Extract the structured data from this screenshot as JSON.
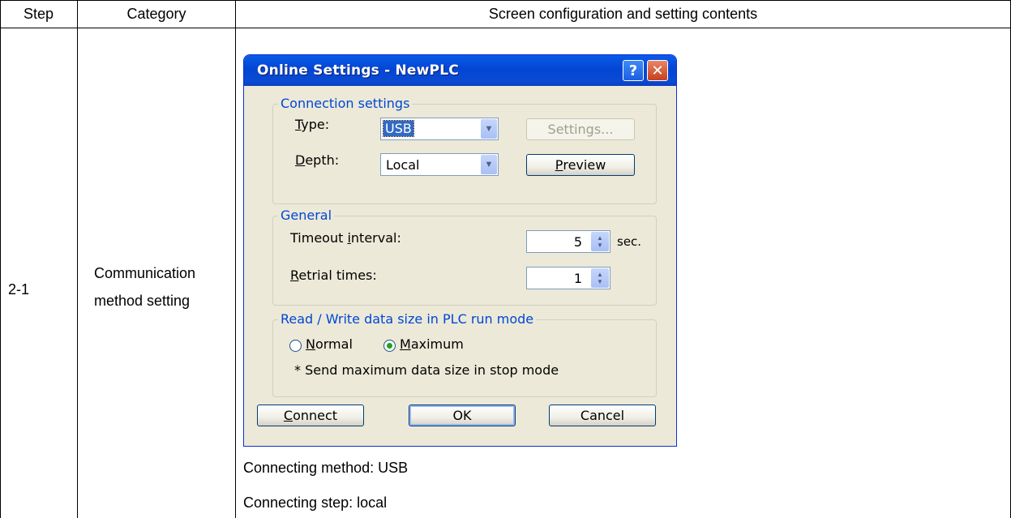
{
  "table": {
    "headers": [
      "Step",
      "Category",
      "Screen configuration and setting contents"
    ],
    "step": "2-1",
    "category_line1": "Communication",
    "category_line2": "method setting",
    "caption_method": "Connecting method: USB",
    "caption_step": "Connecting step: local"
  },
  "dialog": {
    "title": "Online Settings - NewPLC",
    "help_icon": "question-mark",
    "close_icon": "x-mark",
    "connection": {
      "legend": "Connection settings",
      "type_label_u": "T",
      "type_label_rest": "ype:",
      "type_value": "USB",
      "settings_label": "Settings...",
      "depth_label_u": "D",
      "depth_label_rest": "epth:",
      "depth_value": "Local",
      "preview_label_u": "P",
      "preview_label_rest": "review"
    },
    "general": {
      "legend": "General",
      "timeout_label_a": "Timeout ",
      "timeout_label_u": "i",
      "timeout_label_b": "nterval:",
      "timeout_value": "5",
      "timeout_unit": "sec.",
      "retrial_label_u": "R",
      "retrial_label_rest": "etrial times:",
      "retrial_value": "1"
    },
    "runmode": {
      "legend": "Read / Write data size in PLC run mode",
      "normal_u": "N",
      "normal_rest": "ormal",
      "maximum_u": "M",
      "maximum_rest": "aximum",
      "selected": "Maximum",
      "note": "* Send maximum data size in stop mode"
    },
    "buttons": {
      "connect_u": "C",
      "connect_rest": "onnect",
      "ok": "OK",
      "cancel": "Cancel"
    }
  }
}
